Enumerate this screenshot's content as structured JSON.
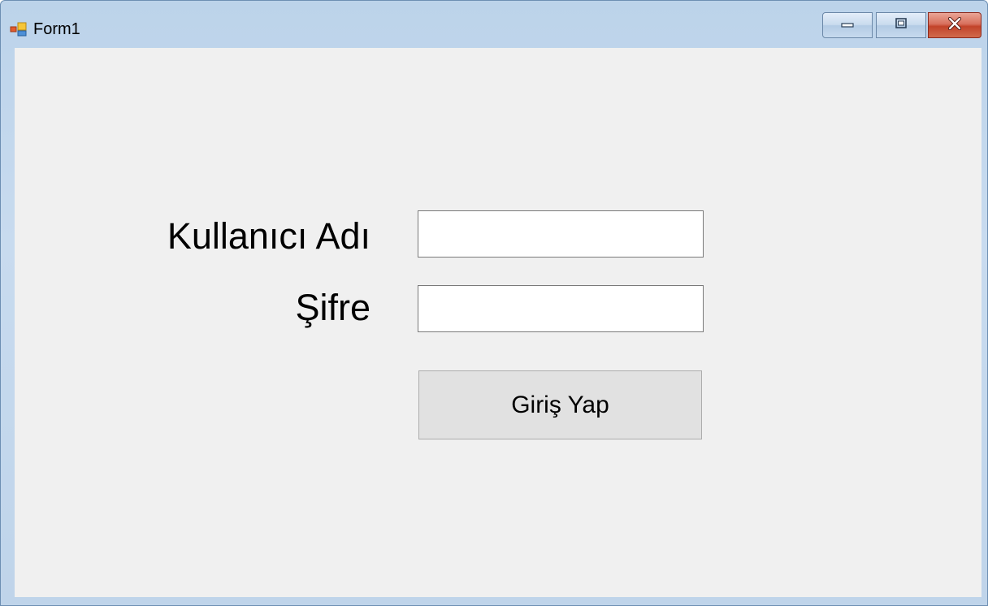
{
  "window": {
    "title": "Form1",
    "app_icon": "winforms-app-icon",
    "controls": {
      "minimize_icon": "minimize-icon",
      "maximize_icon": "maximize-icon",
      "close_icon": "close-icon"
    }
  },
  "form": {
    "username_label": "Kullanıcı Adı",
    "username_value": "",
    "password_label": "Şifre",
    "password_value": "",
    "login_button": "Giriş Yap"
  },
  "colors": {
    "client_background": "#f0f0f0",
    "button_background": "#e1e1e1",
    "close_button": "#c2432a",
    "titlebar": "#bcd3ea"
  }
}
